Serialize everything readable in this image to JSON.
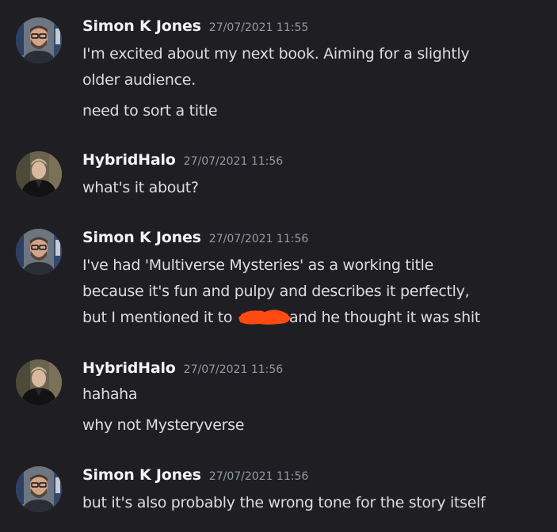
{
  "messages": [
    {
      "author": "Simon K Jones",
      "timestamp": "27/07/2021 11:55",
      "avatar_icon": "avatar-simon",
      "lines": [
        "I'm excited about my next book. Aiming for a slightly",
        "older audience.",
        "need to sort a title"
      ]
    },
    {
      "author": "HybridHalo",
      "timestamp": "27/07/2021 11:56",
      "avatar_icon": "avatar-hybridhalo",
      "lines": [
        "what's it about?"
      ]
    },
    {
      "author": "Simon K Jones",
      "timestamp": "27/07/2021 11:56",
      "avatar_icon": "avatar-simon",
      "lines": [
        "I've had 'Multiverse Mysteries' as a working title",
        "because it's fun and pulpy and describes it perfectly,",
        "but I mentioned it to ",
        "and he thought it was shit"
      ]
    },
    {
      "author": "HybridHalo",
      "timestamp": "27/07/2021 11:56",
      "avatar_icon": "avatar-hybridhalo",
      "lines": [
        "hahaha",
        "why not Mysteryverse"
      ]
    },
    {
      "author": "Simon K Jones",
      "timestamp": "27/07/2021 11:56",
      "avatar_icon": "avatar-simon",
      "lines": [
        "but it's also probably the wrong tone for the story itself"
      ]
    }
  ],
  "colors": {
    "background": "#1f1f23",
    "username": "#f2f3f5",
    "timestamp": "#949ba4",
    "text": "#dbdee1",
    "redaction": "#ff4a12"
  }
}
